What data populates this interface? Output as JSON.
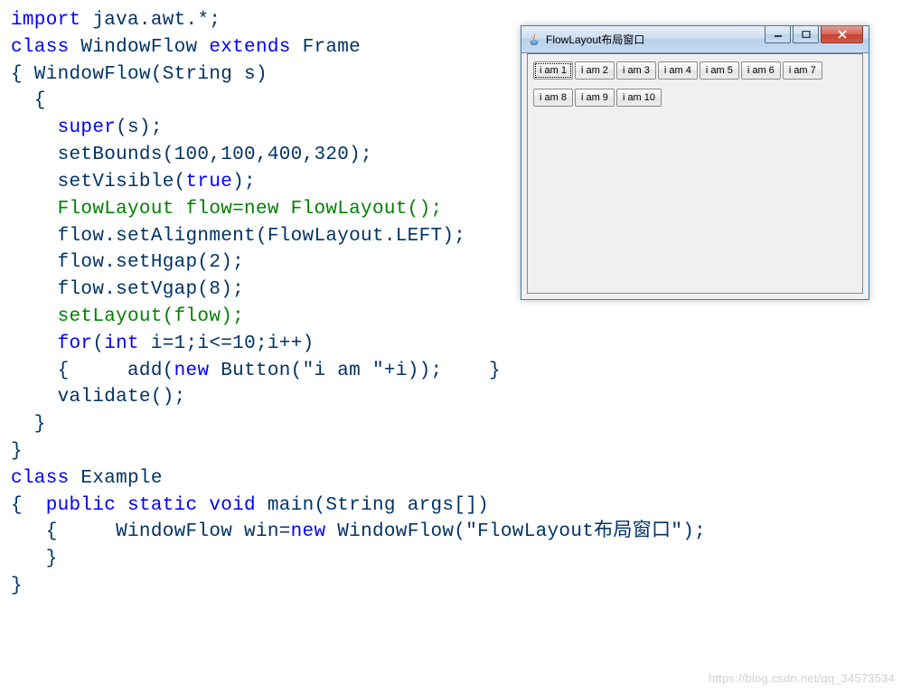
{
  "code": {
    "l1a": "import",
    "l1b": " java.awt.*;",
    "l2a": "class",
    "l2b": " WindowFlow ",
    "l2c": "extends",
    "l2d": " Frame",
    "l3": "{ WindowFlow(String s)",
    "l4": "  {",
    "l5a": "    ",
    "l5b": "super",
    "l5c": "(s);",
    "l6": "    setBounds(100,100,400,320);",
    "l7a": "    setVisible(",
    "l7b": "true",
    "l7c": ");",
    "l8g": "    FlowLayout flow=new FlowLayout();",
    "l9": "    flow.setAlignment(FlowLayout.LEFT);",
    "l10": "    flow.setHgap(2);",
    "l11": "    flow.setVgap(8);",
    "l12g": "    setLayout(flow);",
    "l13a": "    ",
    "l13b": "for",
    "l13c": "(",
    "l13d": "int",
    "l13e": " i=1;i<=10;i++)",
    "l14a": "    {     add(",
    "l14b": "new",
    "l14c": " Button(\"i am \"+i));    }",
    "l15": "    validate();",
    "l16": "  }",
    "l17": "}",
    "l18a": "class",
    "l18b": " Example",
    "l19a": "{  ",
    "l19b": "public static void",
    "l19c": " main(String args[])",
    "l20a": "   {     WindowFlow win=",
    "l20b": "new",
    "l20c": " WindowFlow(\"FlowLayout布局窗口\");",
    "l21": "   }",
    "l22": "}"
  },
  "window": {
    "title": "FlowLayout布局窗口",
    "buttons": [
      "i am 1",
      "i am 2",
      "i am 3",
      "i am 4",
      "i am 5",
      "i am 6",
      "i am 7",
      "i am 8",
      "i am 9",
      "i am 10"
    ]
  },
  "watermark": "https://blog.csdn.net/qq_34573534"
}
